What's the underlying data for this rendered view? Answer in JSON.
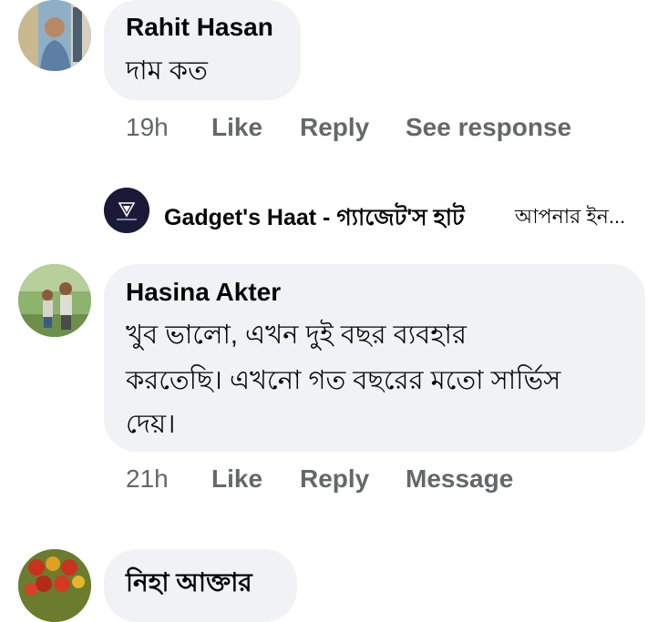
{
  "comments": [
    {
      "author": "Rahit Hasan",
      "lines": [
        "দাম কত"
      ],
      "time": "19h",
      "actions": [
        "Like",
        "Reply",
        "See response"
      ]
    },
    {
      "author": "Hasina Akter",
      "lines": [
        "খুব ভালো, এখন দুই বছর ব্যবহার",
        "করতেছি। এখনো গত বছরের মতো সার্ভিস",
        "দেয়।"
      ],
      "time": "21h",
      "actions": [
        "Like",
        "Reply",
        "Message"
      ]
    },
    {
      "author": "নিহা আক্তার",
      "lines": []
    }
  ],
  "page_reply": {
    "page_name": "Gadget's Haat - গ্যাজেট'স হাট",
    "snippet": "আপনার ইন...",
    "logo_text": "GADGET'S HAAT"
  },
  "colors": {
    "bubble": "#f0f2f5",
    "meta": "#65676b",
    "text": "#050505",
    "logo_bg": "#1e1e3c"
  }
}
